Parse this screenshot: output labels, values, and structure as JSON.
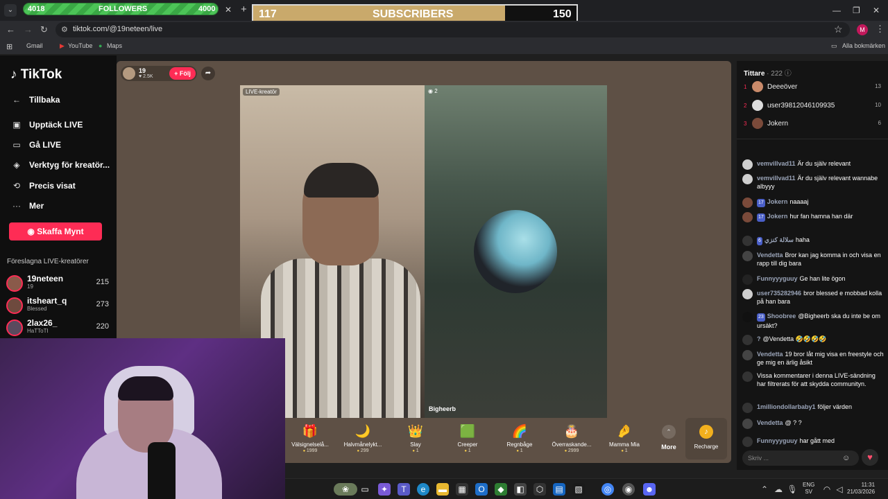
{
  "overlay": {
    "followers": {
      "current": "4018",
      "label": "FOLLOWERS",
      "goal": "4000"
    },
    "subscribers": {
      "current": "117",
      "label": "SUBSCRIBERS",
      "goal": "150",
      "progress_fraction": 0.78
    }
  },
  "browser": {
    "url": "tiktok.com/@19neteen/live",
    "bookmarks": [
      "Gmail",
      "YouTube",
      "Maps"
    ],
    "all_bookmarks": "Alla bokmärken",
    "profile_initial": "M"
  },
  "sidebar": {
    "logo": "TikTok",
    "back": "Tillbaka",
    "items": [
      "Upptäck LIVE",
      "Gå LIVE",
      "Verktyg för kreatör...",
      "Precis visat",
      "Mer"
    ],
    "coins_button": "Skaffa Mynt",
    "suggested_title": "Föreslagna LIVE-kreatörer",
    "suggested": [
      {
        "name": "19neteen",
        "sub": "19",
        "count": "215"
      },
      {
        "name": "itsheart_q",
        "sub": "Blessed",
        "count": "273"
      },
      {
        "name": "2lax26_",
        "sub": "HaTToTI",
        "count": "220"
      }
    ]
  },
  "stage": {
    "host": {
      "name": "19",
      "likes": "2.5K",
      "follow_label": "Följ"
    },
    "live_tag": "LIVE-kreatör",
    "guest_viewers": "2",
    "guest_name": "Bigheerb",
    "gifts": [
      {
        "name": "Välsignelselå...",
        "price": "1999",
        "icon": "🎁"
      },
      {
        "name": "Halvmånelykt...",
        "price": "299",
        "icon": "🌙"
      },
      {
        "name": "Slay",
        "price": "1",
        "icon": "👑"
      },
      {
        "name": "Creeper",
        "price": "1",
        "icon": "🟩"
      },
      {
        "name": "Regnbåge",
        "price": "1",
        "icon": "🌈"
      },
      {
        "name": "Överraskande...",
        "price": "2999",
        "icon": "🎂"
      },
      {
        "name": "Mamma Mia",
        "price": "1",
        "icon": "🤌"
      }
    ],
    "more_label": "More",
    "recharge_label": "Recharge"
  },
  "chat": {
    "viewers_label": "Tittare",
    "viewers_count": "· 222",
    "top_viewers": [
      {
        "rank": "1",
        "name": "Deeeöver",
        "score": "13"
      },
      {
        "rank": "2",
        "name": "user39812046109935",
        "score": "10"
      },
      {
        "rank": "3",
        "name": "Jokern",
        "score": "6"
      }
    ],
    "messages": [
      {
        "user": "vemvillvad11",
        "badge": "",
        "text": "Är du själv relevant"
      },
      {
        "user": "vemvillvad11",
        "badge": "",
        "text": "Är du själv relevant wannabe albyyy"
      },
      {
        "user": "Jokern",
        "badge": "17",
        "text": "naaaaj"
      },
      {
        "user": "Jokern",
        "badge": "17",
        "text": "hur fan hamna han där"
      },
      {
        "user": "سلالة كنزي",
        "badge": "6",
        "text": "haha"
      },
      {
        "user": "Vendetta",
        "badge": "",
        "text": "Bror kan jag komma in och visa en rapp till dig bara"
      },
      {
        "user": "Funnyyyguuy",
        "badge": "",
        "text": "Ge han lite ögon"
      },
      {
        "user": "user735282946",
        "badge": "",
        "text": "bror blessed e mobbad kolla på han bara"
      },
      {
        "user": "Shoobree",
        "badge": "23",
        "text": "@Bigheerb ska du inte be om ursäkt?"
      },
      {
        "user": "?",
        "badge": "",
        "text": "@Vendetta 🤣🤣🤣🤣"
      },
      {
        "user": "Vendetta",
        "badge": "",
        "text": "19 bror låt mig visa en freestyle och ge mig en ärlig åsikt"
      },
      {
        "user": "",
        "badge": "",
        "text": "Vissa kommentarer i denna LIVE-sändning har filtrerats för att skydda communityn."
      },
      {
        "user": "1milliondollarbaby1",
        "badge": "",
        "text": "följer värden"
      },
      {
        "user": "Vendetta",
        "badge": "",
        "text": "@ ? ?"
      },
      {
        "user": "Funnyyyguuy",
        "badge": "",
        "text": "har gått med"
      }
    ],
    "input_placeholder": "Skriv ..."
  },
  "taskbar": {
    "lang": "ENG",
    "lang_sub": "SV",
    "time": "11:31",
    "date": "21/03/2026"
  }
}
